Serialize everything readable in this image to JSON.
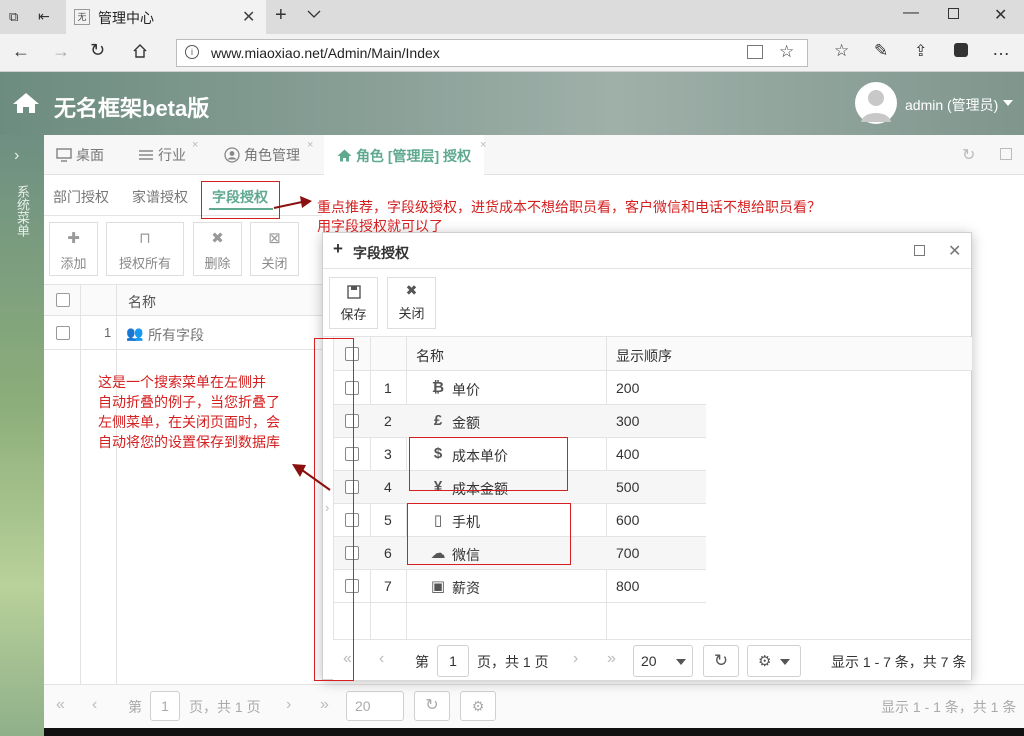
{
  "browser": {
    "tab_title": "管理中心",
    "url": "www.miaoxiao.net/Admin/Main/Index"
  },
  "header": {
    "title": "无名框架beta版",
    "user": "admin (管理员)"
  },
  "rail": {
    "label": "系统菜单"
  },
  "tabs": [
    {
      "label": "桌面"
    },
    {
      "label": "行业"
    },
    {
      "label": "角色管理"
    },
    {
      "label": "角色 [管理层] 授权"
    }
  ],
  "subtabs": [
    "部门授权",
    "家谱授权",
    "字段授权"
  ],
  "toolbar": {
    "add": "添加",
    "authorize_all": "授权所有",
    "delete": "删除",
    "close": "关闭"
  },
  "bg_grid": {
    "column_name": "名称",
    "row_num": "1",
    "row_name": "所有字段"
  },
  "bg_pager": {
    "page_prefix": "第",
    "page_value": "1",
    "page_suffix": "页，共 1 页",
    "page_size": "20",
    "summary": "显示 1 - 1 条，共 1 条"
  },
  "dialog": {
    "title": "字段授权",
    "save": "保存",
    "close": "关闭",
    "col_name": "名称",
    "col_order": "显示顺序",
    "rows": [
      {
        "num": "1",
        "name": "单价",
        "order": "200",
        "icon": "bitcoin-icon"
      },
      {
        "num": "2",
        "name": "金额",
        "order": "300",
        "icon": "pound-icon"
      },
      {
        "num": "3",
        "name": "成本单价",
        "order": "400",
        "icon": "dollar-icon"
      },
      {
        "num": "4",
        "name": "成本金额",
        "order": "500",
        "icon": "yen-icon"
      },
      {
        "num": "5",
        "name": "手机",
        "order": "600",
        "icon": "mobile-icon"
      },
      {
        "num": "6",
        "name": "微信",
        "order": "700",
        "icon": "wechat-icon"
      },
      {
        "num": "7",
        "name": "薪资",
        "order": "800",
        "icon": "id-card-icon"
      }
    ],
    "pager": {
      "page_prefix": "第",
      "page_value": "1",
      "page_suffix": "页，共 1 页",
      "page_size": "20",
      "summary": "显示 1 - 7 条，共 7 条"
    }
  },
  "annotations": {
    "top_line1": "重点推荐，字段级授权，进货成本不想给职员看，客户微信和电话不想给职员看？",
    "top_line2": "用字段授权就可以了",
    "left_line1": "这是一个搜索菜单在左侧并",
    "left_line2": "自动折叠的例子，当您折叠了",
    "left_line3": "左侧菜单，在关闭页面时，会",
    "left_line4": "自动将您的设置保存到数据库"
  },
  "colors": {
    "accent": "#5fa98f",
    "annotation_red": "#d42020"
  }
}
